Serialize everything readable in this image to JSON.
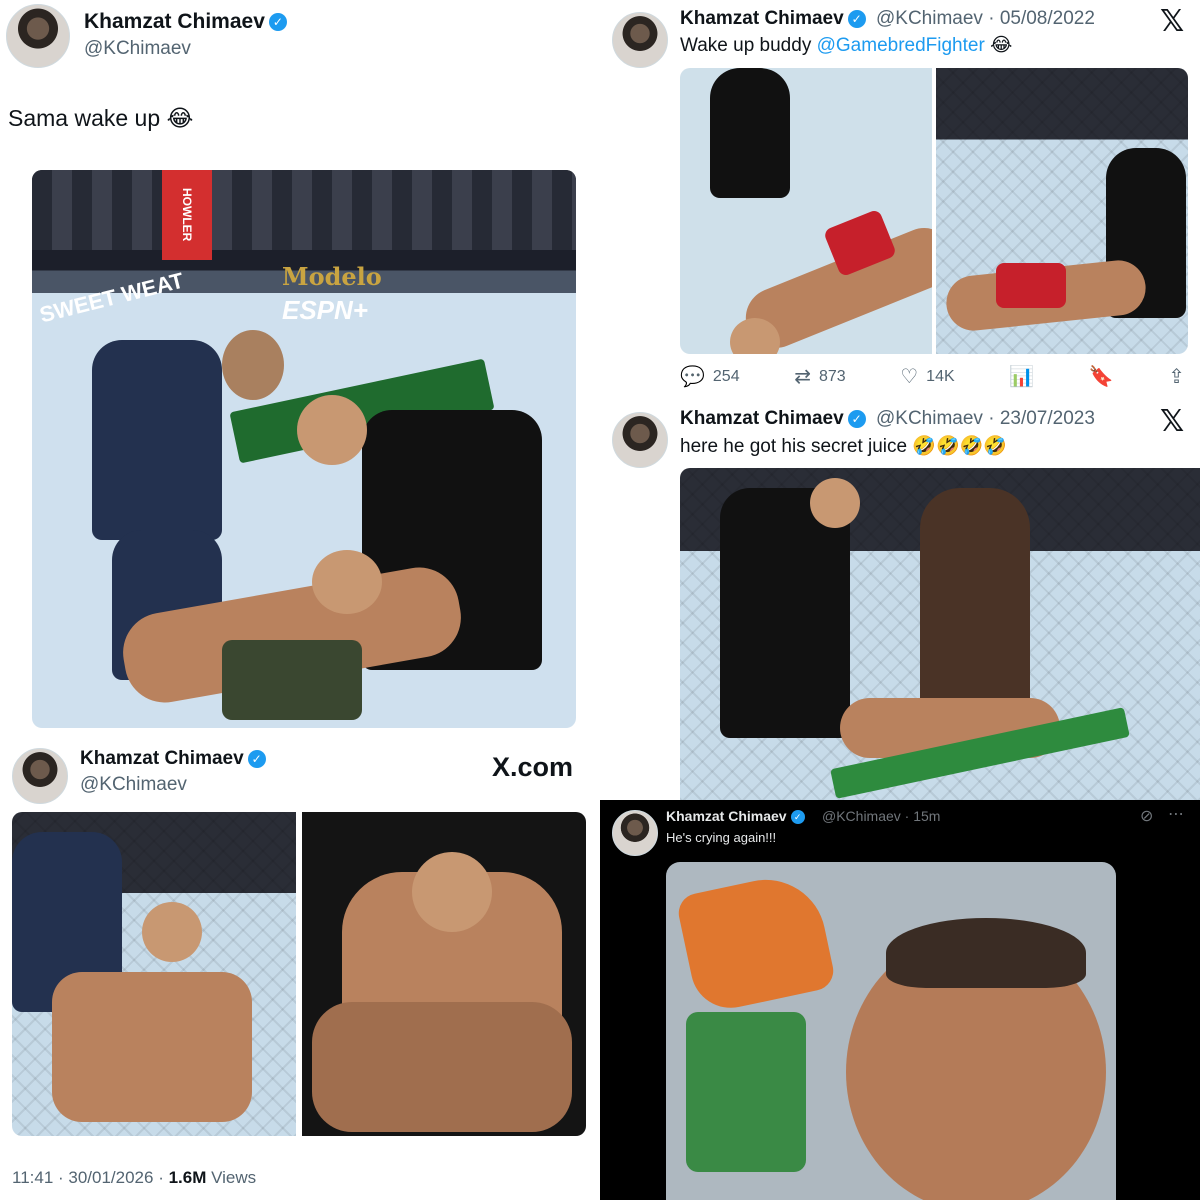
{
  "panel_a": {
    "name": "Khamzat Chimaev",
    "handle": "@KChimaev",
    "text": "Sama wake up 😂",
    "photo_signs": [
      "HOWLER",
      "Modelo",
      "ESPN+",
      "SWEET WEAT"
    ]
  },
  "panel_b": {
    "name": "Khamzat Chimaev",
    "handle": "@KChimaev · 05/08/2022",
    "text_prefix": "Wake up buddy ",
    "mention": "@GamebredFighter",
    "text_suffix": " 😂",
    "x_logo": "𝕏",
    "stats": {
      "replies": "254",
      "reposts": "873",
      "likes": "14K"
    },
    "icons": [
      "reply-icon",
      "repost-icon",
      "like-icon",
      "views-icon",
      "bookmark-icon",
      "share-icon"
    ]
  },
  "panel_c": {
    "name": "Khamzat Chimaev",
    "handle": "@KChimaev · 23/07/2023",
    "text": "here he got his secret juice 🤣🤣🤣🤣",
    "x_logo": "𝕏"
  },
  "panel_d": {
    "name": "Khamzat Chimaev",
    "handle": "@KChimaev",
    "brand": "X.com",
    "time": "11:41 · 30/01/2026 · ",
    "views_count": "1.6M",
    "views_label": " Views"
  },
  "panel_e": {
    "name": "Khamzat Chimaev",
    "handle": "@KChimaev · 15m",
    "text": "He's crying again!!!",
    "more_icon": "⋯"
  },
  "colors": {
    "accent": "#1d9bf0",
    "text": "#0f1419",
    "muted": "#536471",
    "dark_bg": "#000000"
  }
}
